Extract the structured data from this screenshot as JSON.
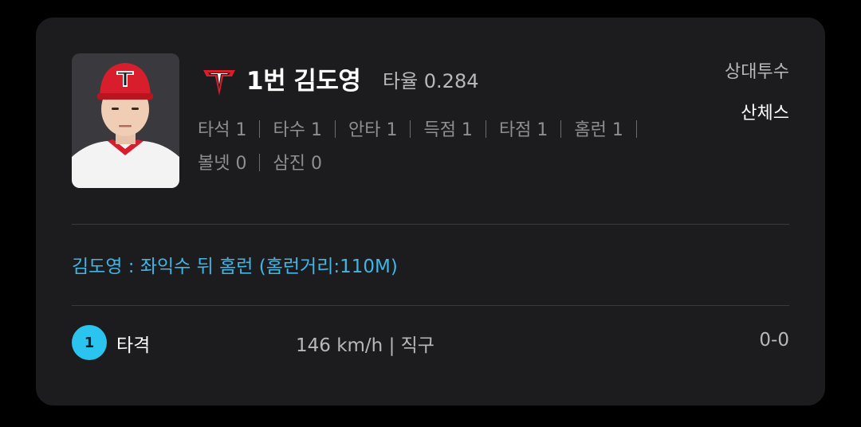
{
  "player": {
    "order_name": "1번 김도영",
    "avg_label": "타율 0.284"
  },
  "opponent": {
    "label": "상대투수",
    "pitcher": "산체스"
  },
  "stats": [
    {
      "label": "타석 1"
    },
    {
      "label": "타수 1"
    },
    {
      "label": "안타 1"
    },
    {
      "label": "득점 1"
    },
    {
      "label": "타점 1"
    },
    {
      "label": "홈런 1"
    },
    {
      "label": "볼넷 0"
    },
    {
      "label": "삼진 0"
    }
  ],
  "play_description": "김도영 : 좌익수 뒤 홈런 (홈런거리:110M)",
  "pitch": {
    "number": "1",
    "result": "타격",
    "info": "146 km/h | 직구",
    "count": "0-0"
  },
  "colors": {
    "card_bg": "#1c1c1e",
    "accent": "#2bc4ee",
    "description": "#3fb6e6",
    "team_red": "#d81e2c"
  },
  "icons": {
    "team_logo": "tigers-logo-icon",
    "player_photo": "player-avatar"
  }
}
